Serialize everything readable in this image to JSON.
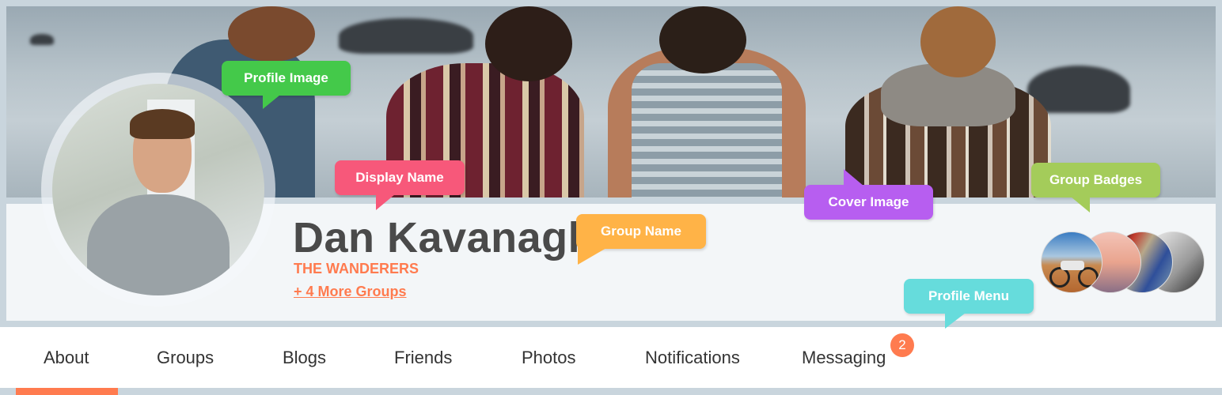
{
  "profile": {
    "display_name": "Dan Kavanagh",
    "group_name": "THE WANDERERS",
    "more_groups_link": "+ 4 More Groups"
  },
  "nav": {
    "items": [
      {
        "label": "About",
        "active": true
      },
      {
        "label": "Groups"
      },
      {
        "label": "Blogs"
      },
      {
        "label": "Friends"
      },
      {
        "label": "Photos"
      },
      {
        "label": "Notifications"
      },
      {
        "label": "Messaging",
        "badge": "2"
      }
    ]
  },
  "group_badges": [
    {
      "name": "dirt-bike-desert"
    },
    {
      "name": "sunset-dune"
    },
    {
      "name": "scarves-dog"
    },
    {
      "name": "dog-portrait"
    }
  ],
  "callouts": {
    "profile_image": {
      "label": "Profile Image",
      "color": "#44c94a"
    },
    "display_name": {
      "label": "Display Name",
      "color": "#f7587a"
    },
    "group_name": {
      "label": "Group Name",
      "color": "#ffb347"
    },
    "cover_image": {
      "label": "Cover Image",
      "color": "#b75ef0"
    },
    "group_badges": {
      "label": "Group Badges",
      "color": "#a4cc5a"
    },
    "profile_menu": {
      "label": "Profile Menu",
      "color": "#66dcdc"
    }
  },
  "colors": {
    "accent": "#ff7b4f",
    "frame": "#c9d5dd",
    "panel": "#f3f6f8",
    "name_text": "#4a4a4a"
  }
}
